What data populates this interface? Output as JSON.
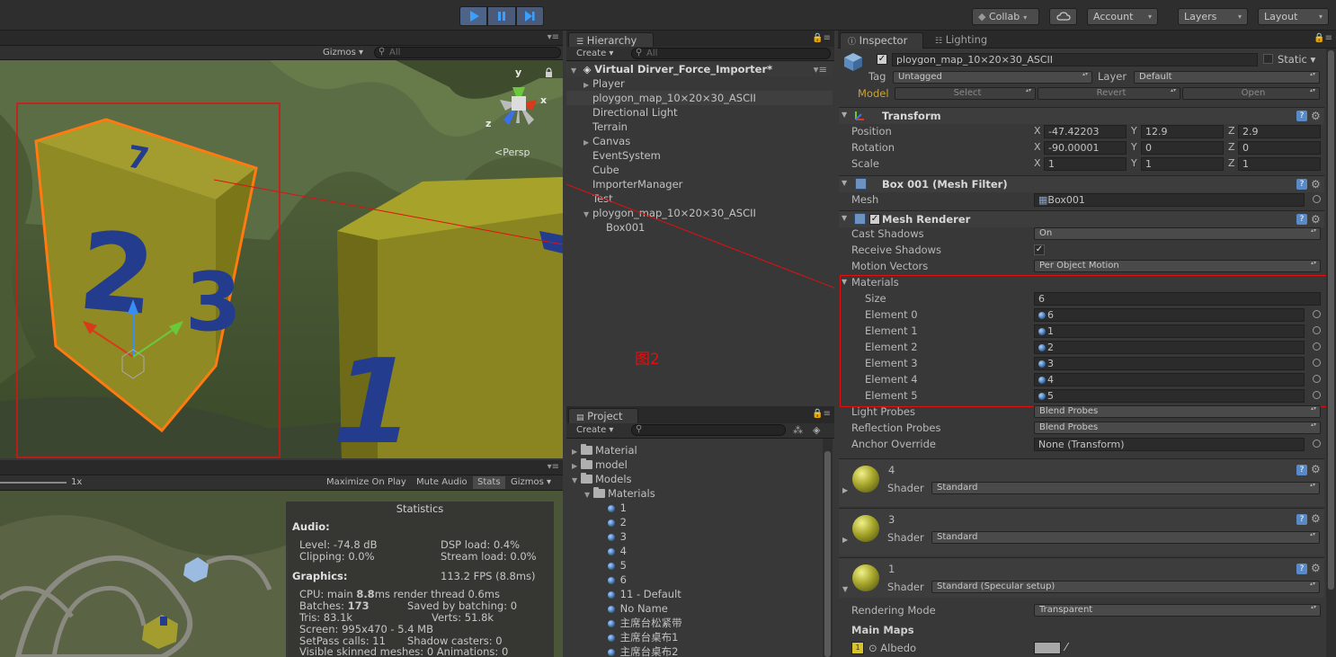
{
  "toolbar": {
    "collab": "Collab",
    "account": "Account",
    "layers": "Layers",
    "layout": "Layout"
  },
  "scene": {
    "gizmos": "Gizmos",
    "search_placeholder": "All",
    "persp": "<Persp",
    "axis_x": "x",
    "axis_y": "y",
    "axis_z": "z",
    "cube_numbers": [
      "7",
      "2",
      "3",
      "1"
    ]
  },
  "game": {
    "scale_label": "1x",
    "maximize": "Maximize On Play",
    "mute": "Mute Audio",
    "stats": "Stats",
    "gizmos": "Gizmos",
    "statistics": {
      "title": "Statistics",
      "audio_h": "Audio:",
      "level": "Level: -74.8 dB",
      "clipping": "Clipping: 0.0%",
      "dsp": "DSP load: 0.4%",
      "stream": "Stream load: 0.0%",
      "graphics_h": "Graphics:",
      "fps": "113.2 FPS (8.8ms)",
      "cpu_pre": "CPU: main ",
      "cpu_bold": "8.8",
      "cpu_post": "ms  render thread 0.6ms",
      "batches_pre": "Batches: ",
      "batches_bold": "173",
      "saved": "Saved by batching: 0",
      "tris": "Tris: 83.1k",
      "verts": "Verts: 51.8k",
      "screen": "Screen: 995x470 - 5.4 MB",
      "setpass": "SetPass calls: 11",
      "shadow": "Shadow casters: 0",
      "visible": "Visible skinned meshes: 0  Animations: 0"
    }
  },
  "hierarchy": {
    "tab": "Hierarchy",
    "create": "Create",
    "search_placeholder": "All",
    "scene_name": "Virtual Dirver_Force_Importer*",
    "items": [
      {
        "label": "Player"
      },
      {
        "label": "ploygon_map_10×20×30_ASCII"
      },
      {
        "label": "Directional Light"
      },
      {
        "label": "Terrain"
      },
      {
        "label": "Canvas"
      },
      {
        "label": "EventSystem"
      },
      {
        "label": "Cube"
      },
      {
        "label": "ImporterManager"
      },
      {
        "label": "Test"
      },
      {
        "label": "ploygon_map_10×20×30_ASCII"
      },
      {
        "label": "Box001"
      }
    ],
    "annotation": "图2"
  },
  "project": {
    "tab": "Project",
    "create": "Create",
    "items": [
      "Material",
      "model",
      "Models",
      "Materials",
      "1",
      "2",
      "3",
      "4",
      "5",
      "6",
      "11 - Default",
      "No Name",
      "主席台松紧带",
      "主席台桌布1",
      "主席台桌布2"
    ]
  },
  "inspector": {
    "tab": "Inspector",
    "lighting_tab": "Lighting",
    "object_name": "ploygon_map_10×20×30_ASCII",
    "static": "Static",
    "tag_label": "Tag",
    "tag_value": "Untagged",
    "layer_label": "Layer",
    "layer_value": "Default",
    "model_label": "Model",
    "select": "Select",
    "revert": "Revert",
    "open": "Open",
    "transform": {
      "title": "Transform",
      "position": "Position",
      "rotation": "Rotation",
      "scale": "Scale",
      "pos": [
        "-47.42203",
        "12.9",
        "2.9"
      ],
      "rot": [
        "-90.00001",
        "0",
        "0"
      ],
      "scl": [
        "1",
        "1",
        "1"
      ],
      "x": "X",
      "y": "Y",
      "z": "Z"
    },
    "mesh_filter": {
      "title": "Box 001 (Mesh Filter)",
      "mesh_label": "Mesh",
      "mesh_value": "Box001"
    },
    "mesh_renderer": {
      "title": "Mesh Renderer",
      "cast_label": "Cast Shadows",
      "cast_value": "On",
      "receive_label": "Receive Shadows",
      "motion_label": "Motion Vectors",
      "motion_value": "Per Object Motion",
      "materials_label": "Materials",
      "size_label": "Size",
      "size_value": "6",
      "elements": [
        {
          "label": "Element 0",
          "value": "6"
        },
        {
          "label": "Element 1",
          "value": "1"
        },
        {
          "label": "Element 2",
          "value": "2"
        },
        {
          "label": "Element 3",
          "value": "3"
        },
        {
          "label": "Element 4",
          "value": "4"
        },
        {
          "label": "Element 5",
          "value": "5"
        }
      ],
      "light_probes_label": "Light Probes",
      "light_probes_value": "Blend Probes",
      "refl_label": "Reflection Probes",
      "refl_value": "Blend Probes",
      "anchor_label": "Anchor Override",
      "anchor_value": "None (Transform)"
    },
    "materials": [
      {
        "name": "4",
        "shader_label": "Shader",
        "shader": "Standard"
      },
      {
        "name": "3",
        "shader_label": "Shader",
        "shader": "Standard"
      },
      {
        "name": "1",
        "shader_label": "Shader",
        "shader": "Standard (Specular setup)"
      }
    ],
    "rendering_mode_label": "Rendering Mode",
    "rendering_mode_value": "Transparent",
    "main_maps": "Main Maps",
    "albedo": "Albedo"
  },
  "colors": {
    "highlight_red": "#e01010",
    "selection_orange": "#ff7a10",
    "play_blue": "#4d6488"
  }
}
